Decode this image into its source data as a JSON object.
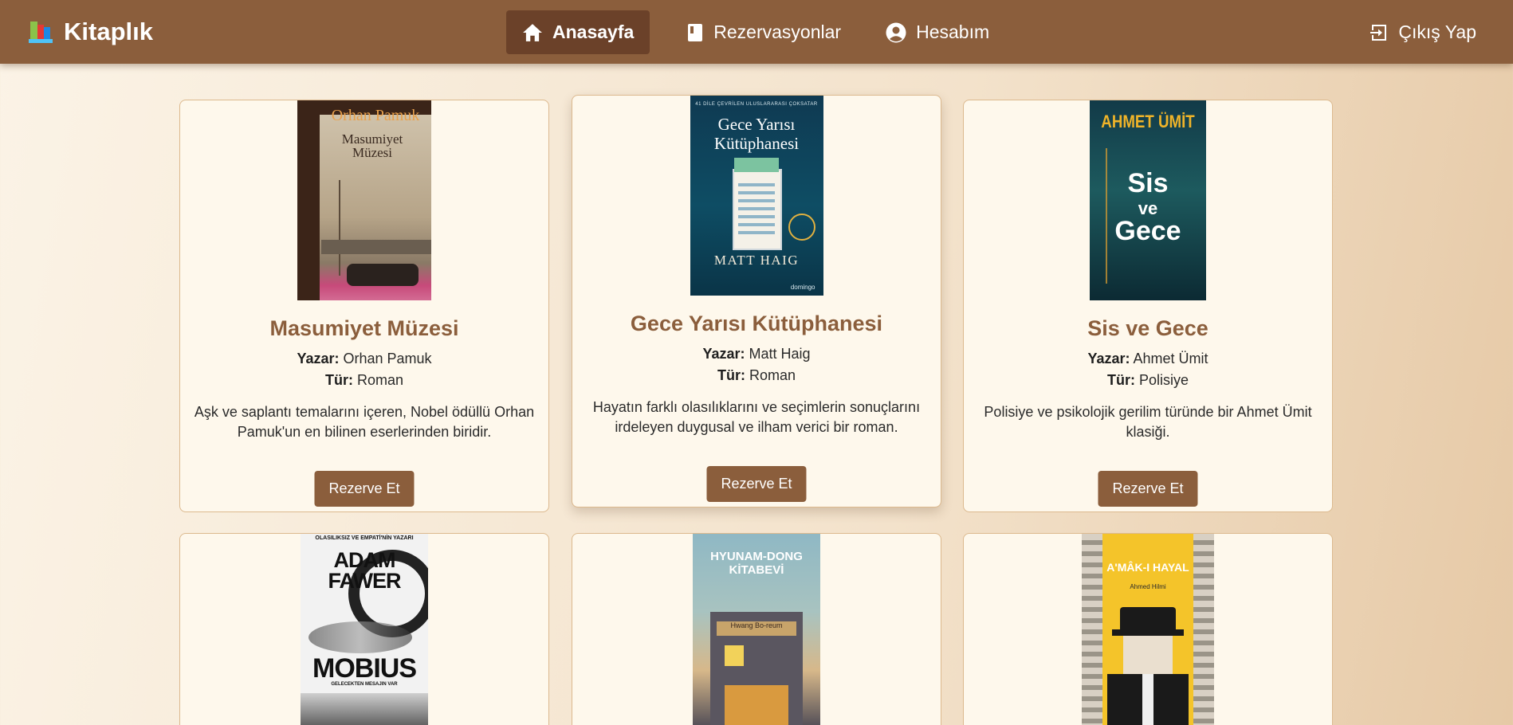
{
  "nav": {
    "brand": "Kitaplık",
    "links": [
      {
        "label": "Anasayfa",
        "icon": "home-icon",
        "active": true
      },
      {
        "label": "Rezervasyonlar",
        "icon": "book-icon",
        "active": false
      },
      {
        "label": "Hesabım",
        "icon": "user-circle-icon",
        "active": false
      }
    ],
    "logout": "Çıkış Yap"
  },
  "labels": {
    "author": "Yazar:",
    "genre": "Tür:",
    "reserve": "Rezerve Et"
  },
  "books": [
    {
      "title": "Masumiyet Müzesi",
      "author": "Orhan Pamuk",
      "genre": "Roman",
      "description": "Aşk ve saplantı temalarını içeren, Nobel ödüllü Orhan Pamuk'un en bilinen eserlerinden biridir.",
      "cover": {
        "author": "Orhan Pamuk",
        "title_line1": "Masumiyet",
        "title_line2": "Müzesi"
      }
    },
    {
      "title": "Gece Yarısı Kütüphanesi",
      "author": "Matt Haig",
      "genre": "Roman",
      "description": "Hayatın farklı olasılıklarını ve seçimlerin sonuçlarını irdeleyen duygusal ve ilham verici bir roman.",
      "cover": {
        "top": "41 DİLE ÇEVRİLEN ULUSLARARASI ÇOKSATAR",
        "title_line1": "Gece Yarısı",
        "title_line2": "Kütüphanesi",
        "author": "MATT HAIG",
        "publisher": "domingo"
      }
    },
    {
      "title": "Sis ve Gece",
      "author": "Ahmet Ümit",
      "genre": "Polisiye",
      "description": "Polisiye ve psikolojik gerilim türünde bir Ahmet Ümit klasiği.",
      "cover": {
        "author": "AHMET ÜMİT",
        "t1": "Sis",
        "t2": "ve",
        "t3": "Gece"
      }
    },
    {
      "cover": {
        "top": "OLASILIKSIZ VE EMPATİ'NİN YAZARI",
        "author1": "ADAM",
        "author2": "FAWER",
        "title": "MOBIUS",
        "sub": "GELECEKTEN MESAJIN VAR"
      }
    },
    {
      "cover": {
        "title1": "HYUNAM-DONG",
        "title2": "KİTABEVİ",
        "author": "Hwang Bo-reum"
      }
    },
    {
      "cover": {
        "title": "A'MÂK-I HAYAL",
        "author": "Ahmed Hilmi"
      }
    }
  ],
  "colors": {
    "nav_bg": "#8b5e3c",
    "nav_active": "#6b4129",
    "title": "#8b5e3c",
    "button": "#8b5e3c",
    "card_bg": "#fef8ec"
  }
}
